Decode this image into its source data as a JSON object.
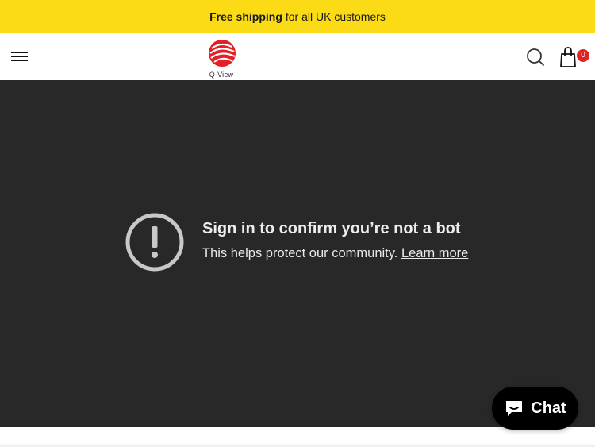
{
  "announcement": {
    "bold": "Free shipping",
    "rest": "for all UK customers"
  },
  "header": {
    "logo_text": "Q-View",
    "cart_count": "0",
    "icons": {
      "menu": "hamburger-icon",
      "search": "search-icon",
      "cart": "shopping-bag-icon"
    }
  },
  "video": {
    "title": "Sign in to confirm you’re not a bot",
    "subtitle": "This helps protect our community.",
    "link": "Learn more",
    "icon": "alert-circle-icon"
  },
  "chat": {
    "label": "Chat",
    "icon": "chat-bubble-icon"
  },
  "colors": {
    "announcement_bg": "#fbdb16",
    "video_bg": "#282828",
    "badge": "#e02424",
    "logo_red": "#e32026",
    "chat_bg": "#000000"
  }
}
